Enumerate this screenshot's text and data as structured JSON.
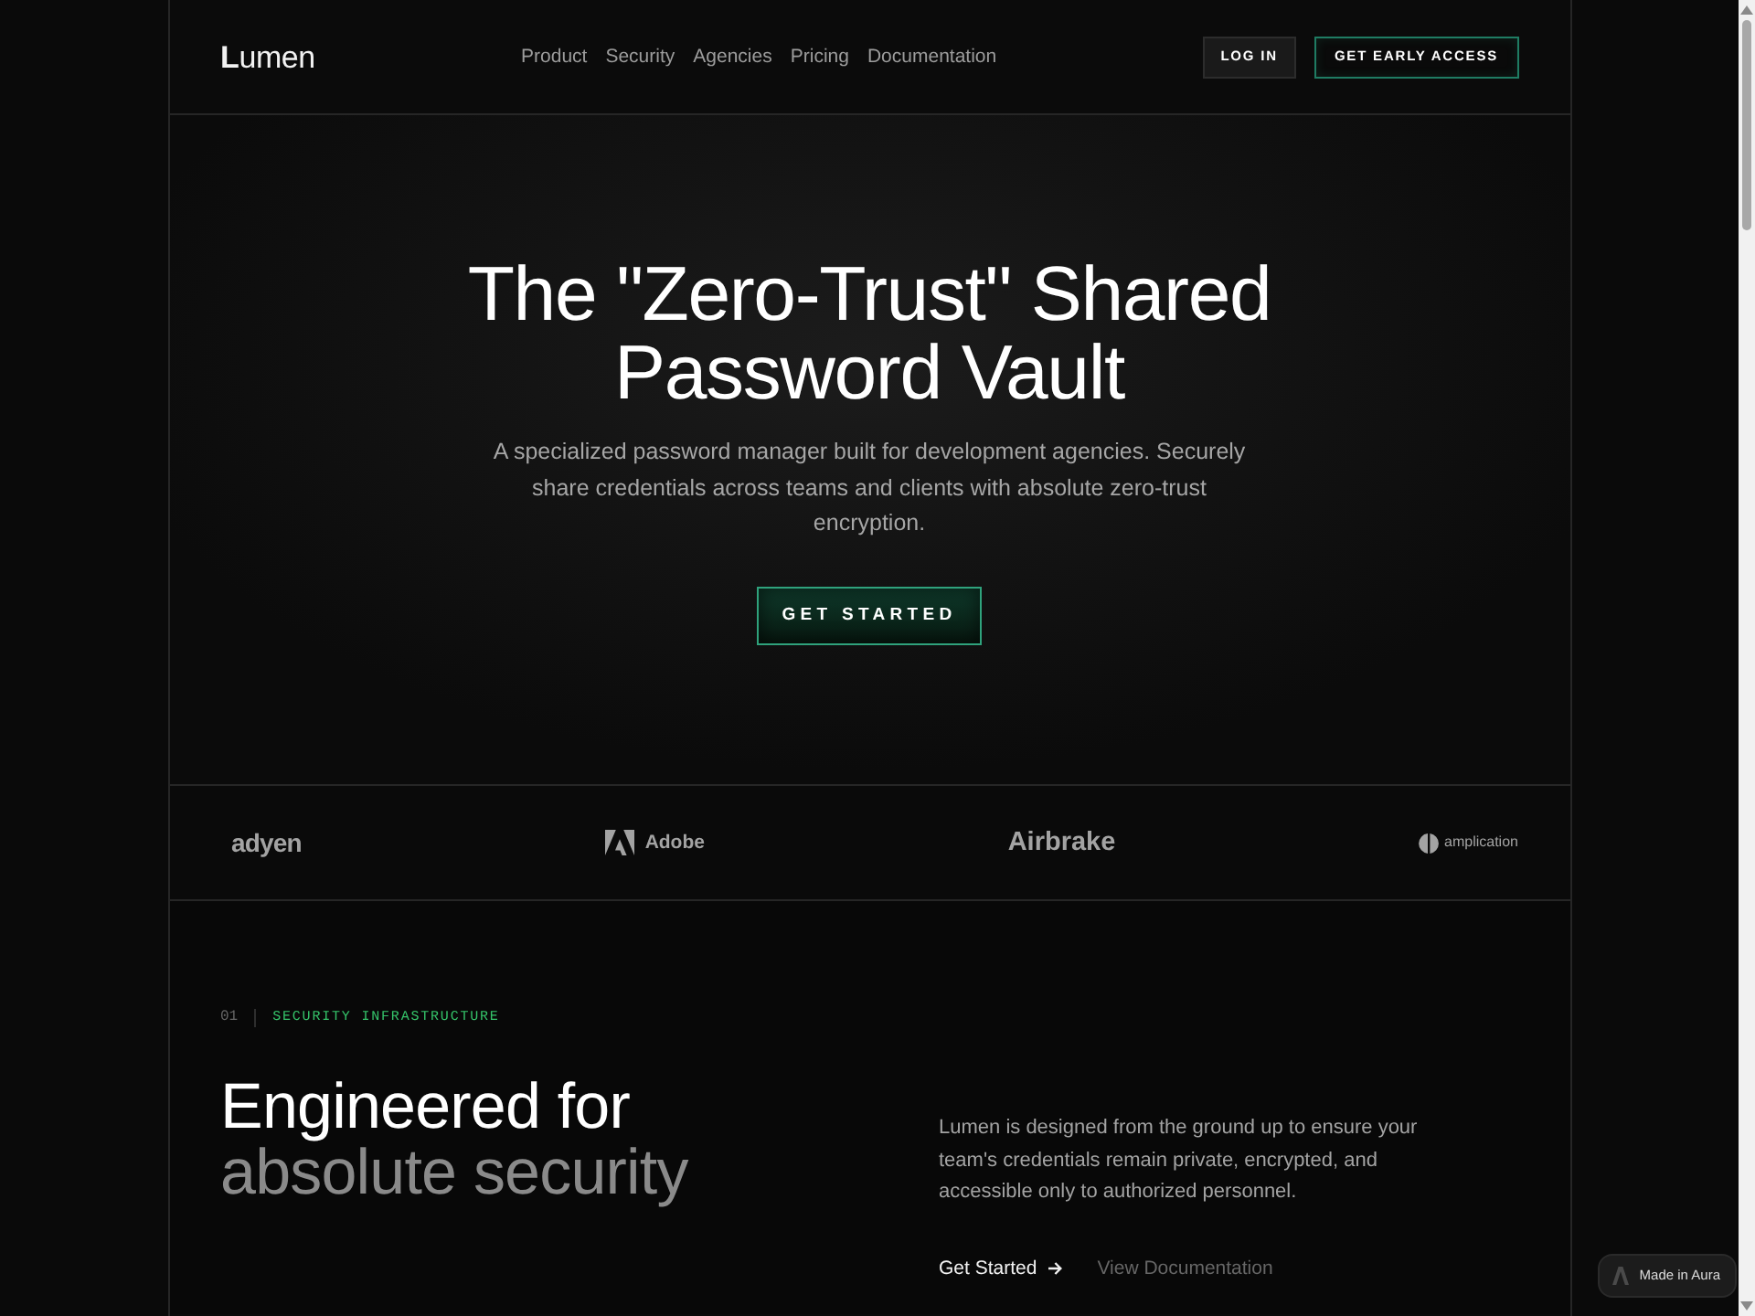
{
  "nav": {
    "logo": "**L**umen",
    "links": [
      "Product",
      "Security",
      "Agencies",
      "Pricing",
      "Documentation"
    ],
    "buttons": [
      {
        "label": "LOG IN",
        "kind": "secondary"
      },
      {
        "label": "GET EARLY ACCESS",
        "kind": "accent"
      }
    ]
  },
  "hero": {
    "title": "The \"Zero-Trust\" Shared Password Vault",
    "subtitle": "A specialized password manager built for development agencies. Securely share credentials across teams and clients with absolute zero-trust encryption.",
    "button": "GET STARTED"
  },
  "logos": [
    {
      "text": "adyen",
      "kind": "heavy"
    },
    {
      "text": "Adobe",
      "kind": "triangle"
    },
    {
      "text": "Airbrake",
      "kind": "bold"
    },
    {
      "text": "amplication",
      "kind": "split"
    }
  ],
  "section": {
    "number": "01",
    "eyebrow": "SECURITY INFRASTRUCTURE",
    "heading": {
      "lead": "Engineered for",
      "muted": "absolute security"
    },
    "body": "Lumen is designed from the ground up to ensure your team's credentials remain private, encrypted, and accessible only to authorized personnel.",
    "links": [
      {
        "label": "Get Started",
        "kind": "primary"
      },
      {
        "label": "View Documentation",
        "kind": "muted"
      }
    ]
  },
  "badge": {
    "label": "Made in Aura"
  }
}
